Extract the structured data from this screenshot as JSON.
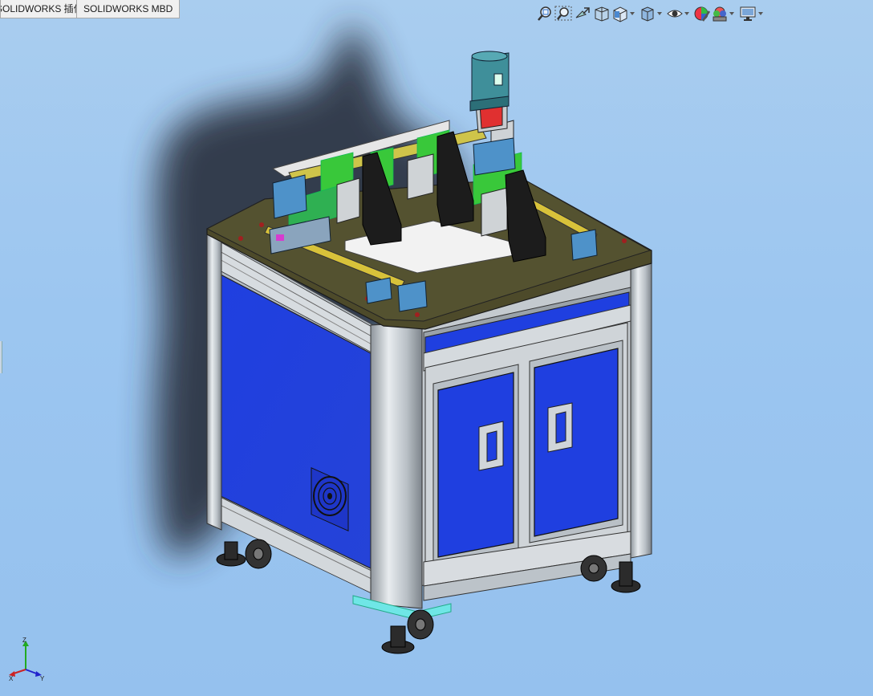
{
  "tabs": [
    {
      "label": "SOLIDWORKS 插件"
    },
    {
      "label": "SOLIDWORKS MBD"
    }
  ],
  "toolbar": {
    "icons": [
      "zoom-to-fit-icon",
      "zoom-to-area-icon",
      "previous-view-icon",
      "section-view-icon",
      "view-orientation-icon",
      "display-style-icon",
      "hide-show-items-icon",
      "edit-appearance-icon",
      "apply-scene-icon",
      "view-settings-icon"
    ]
  },
  "triad": {
    "z": "Z",
    "x": "X",
    "y": "Y"
  }
}
